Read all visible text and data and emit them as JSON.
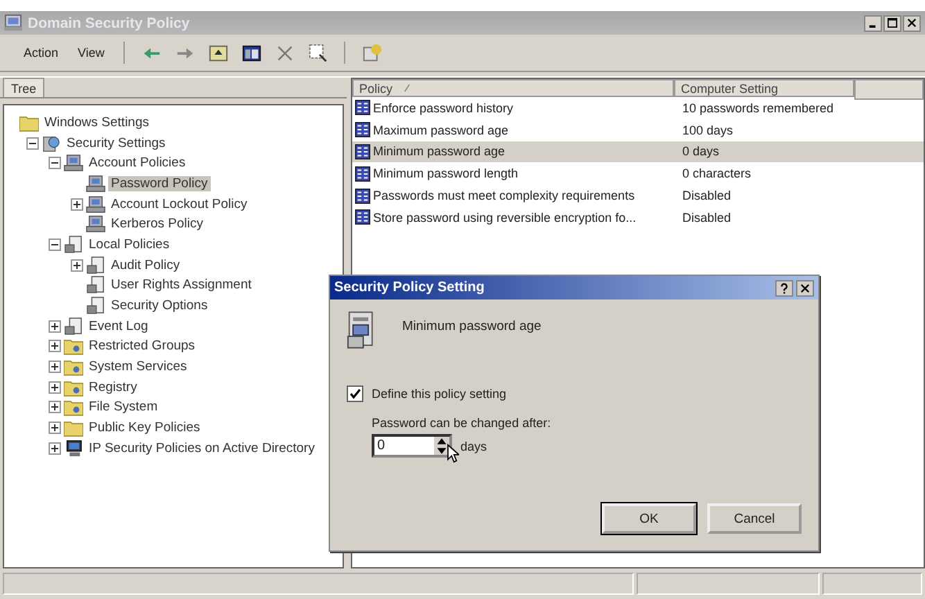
{
  "window": {
    "title": "Domain Security Policy"
  },
  "menu": [
    "Action",
    "View"
  ],
  "tree_tab": "Tree",
  "tree": [
    {
      "label": "Windows Settings",
      "kind": "folder",
      "selected": false,
      "children": [
        {
          "label": "Security Settings",
          "kind": "globe",
          "selected": false,
          "expanded": true,
          "children": [
            {
              "label": "Account Policies",
              "kind": "server",
              "selected": false,
              "expanded": true,
              "children": [
                {
                  "label": "Password Policy",
                  "kind": "server",
                  "selected": true
                },
                {
                  "label": "Account Lockout Policy",
                  "kind": "server",
                  "selected": false,
                  "expanded": false
                },
                {
                  "label": "Kerberos Policy",
                  "kind": "server",
                  "selected": false
                }
              ]
            },
            {
              "label": "Local Policies",
              "kind": "document",
              "selected": false,
              "expanded": true,
              "children": [
                {
                  "label": "Audit Policy",
                  "kind": "document",
                  "selected": false,
                  "expanded": false
                },
                {
                  "label": "User Rights Assignment",
                  "kind": "document",
                  "selected": false
                },
                {
                  "label": "Security Options",
                  "kind": "document",
                  "selected": false
                }
              ]
            },
            {
              "label": "Event Log",
              "kind": "document",
              "selected": false,
              "expanded": false
            },
            {
              "label": "Restricted Groups",
              "kind": "folder-gear",
              "selected": false,
              "expanded": false
            },
            {
              "label": "System Services",
              "kind": "folder-gear",
              "selected": false,
              "expanded": false
            },
            {
              "label": "Registry",
              "kind": "folder-gear",
              "selected": false,
              "expanded": false
            },
            {
              "label": "File System",
              "kind": "folder-gear",
              "selected": false,
              "expanded": false
            },
            {
              "label": "Public Key Policies",
              "kind": "folder",
              "selected": false,
              "expanded": false
            },
            {
              "label": "IP Security Policies on Active Directory",
              "kind": "monitor",
              "selected": false,
              "expanded": false
            }
          ]
        }
      ]
    }
  ],
  "list": {
    "columns": [
      "Policy",
      "Computer Setting"
    ],
    "rows": [
      {
        "policy": "Enforce password history",
        "setting": "10 passwords remembered",
        "selected": false
      },
      {
        "policy": "Maximum password age",
        "setting": "100 days",
        "selected": false
      },
      {
        "policy": "Minimum password age",
        "setting": "0 days",
        "selected": true
      },
      {
        "policy": "Minimum password length",
        "setting": "0 characters",
        "selected": false
      },
      {
        "policy": "Passwords must meet complexity requirements",
        "setting": "Disabled",
        "selected": false
      },
      {
        "policy": "Store password using reversible encryption fo...",
        "setting": "Disabled",
        "selected": false
      }
    ]
  },
  "dialog": {
    "title": "Security Policy Setting",
    "policy_name": "Minimum password age",
    "define": {
      "label": "Define this policy setting",
      "checked": true
    },
    "spin_label": "Password can be changed after:",
    "spin_value": "0",
    "unit": "days",
    "buttons": [
      "OK",
      "Cancel"
    ]
  }
}
